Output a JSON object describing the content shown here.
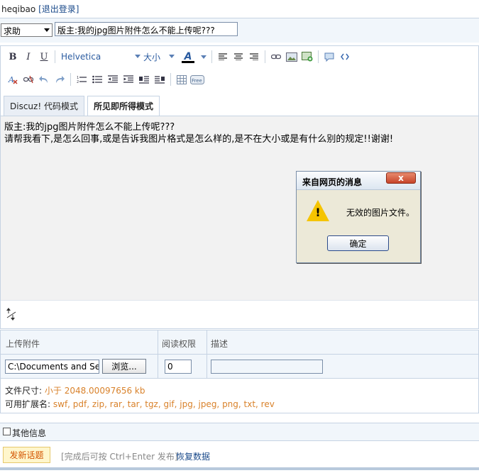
{
  "header": {
    "username": "heqibao",
    "logout_label": "[退出登录]"
  },
  "post": {
    "type_select_value": "求助",
    "subject_value": "版主:我的jpg图片附件怎么不能上传呢???"
  },
  "toolbar": {
    "bold": "B",
    "italic": "I",
    "underline": "U",
    "font_family": "Helvetica",
    "font_size": "大小",
    "font_color": "A",
    "icons_row1": [
      "bold-icon",
      "italic-icon",
      "underline-icon",
      "font-family-select",
      "font-size-select",
      "font-color-icon",
      "align-left-icon",
      "align-center-icon",
      "align-right-icon",
      "link-icon",
      "image-icon",
      "insert-image-icon",
      "emoticon-icon",
      "code-icon"
    ],
    "icons_row2": [
      "remove-format-icon",
      "unlink-icon",
      "undo-icon",
      "redo-icon",
      "ordered-list-icon",
      "unordered-list-icon",
      "outdent-icon",
      "indent-icon",
      "float-left-icon",
      "float-right-icon",
      "table-icon",
      "free-icon"
    ],
    "free_label": "Free"
  },
  "editor": {
    "tabs": [
      {
        "label": "Discuz! 代码模式",
        "active": false
      },
      {
        "label": "所见即所得模式",
        "active": true
      }
    ],
    "content_lines": [
      "版主:我的jpg图片附件怎么不能上传呢???",
      "请帮我看下,是怎么回事,或是告诉我图片格式是怎么样的,是不在大小或是有什么别的规定!!谢谢!"
    ]
  },
  "dialog": {
    "title": "来自网页的消息",
    "close_label": "x",
    "message": "无效的图片文件。",
    "ok_label": "确定"
  },
  "attachments": {
    "col_upload": "上传附件",
    "col_permission": "阅读权限",
    "col_description": "描述",
    "file_path_value": "C:\\Documents and Setti",
    "browse_label": "浏览...",
    "permission_value": "0",
    "size_label": "文件尺寸:",
    "size_value": "小于 2048.00097656 kb",
    "ext_label": "可用扩展名:",
    "ext_value": "swf, pdf, zip, rar, tar, tgz, gif, jpg, jpeg, png, txt, rev"
  },
  "other_info_label": "其他信息",
  "actions": {
    "submit_label": "发新话题",
    "hint": "[完成后可按 Ctrl+Enter 发布]",
    "restore_label": "恢复数据"
  }
}
